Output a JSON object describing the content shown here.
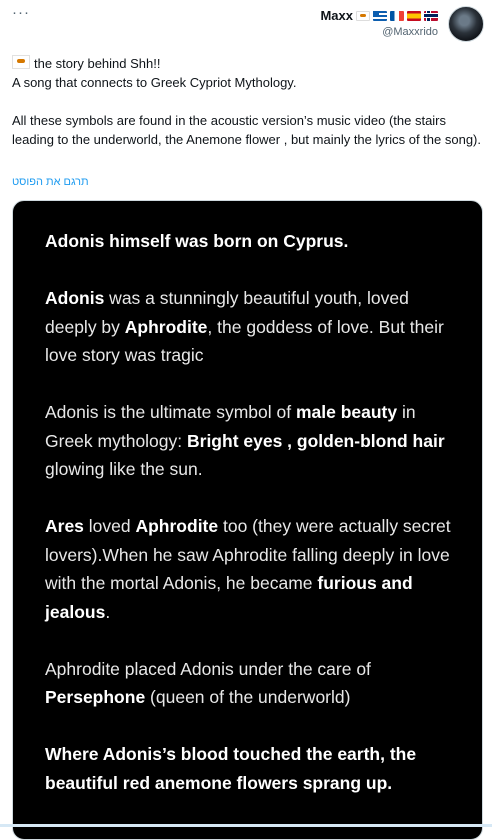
{
  "toolbar": {
    "more_label": "···"
  },
  "author": {
    "name": "Maxx",
    "handle": "@Maxxrido",
    "flags": [
      "cyprus-flag",
      "greece-flag",
      "france-flag",
      "spain-flag",
      "norway-flag"
    ]
  },
  "post": {
    "line1": "the story behind Shh!!",
    "line2": "A song that connects to Greek Cypriot Mythology.",
    "line3": "All these symbols are found in the acoustic version’s music video (the stairs leading to the underworld, the Anemone flower , but mainly the lyrics of the song).",
    "translate_label": "תרגם את הפוסט"
  },
  "image_text": {
    "p1": "Adonis himself was born on Cyprus.",
    "p2": {
      "b1": "Adonis",
      "t1": " was a stunningly beautiful youth, loved deeply by ",
      "b2": "Aphrodite",
      "t2": ", the goddess of love. But their love story was tragic"
    },
    "p3": {
      "t1": "Adonis is the ultimate symbol of ",
      "b1": "male beauty",
      "t2": " in Greek mythology: ",
      "b2": "Bright eyes , golden-blond hair",
      "t3": " glowing like the sun."
    },
    "p4": {
      "b1": "Ares",
      "t1": " loved ",
      "b2": "Aphrodite",
      "t2": " too (they were actually secret lovers).When he saw Aphrodite falling deeply in love with the mortal Adonis, he became ",
      "b3": "furious and jealous",
      "t3": "."
    },
    "p5": {
      "t1": "Aphrodite placed Adonis under the care of ",
      "b1": "Persephone",
      "t2": " (queen of the underworld)"
    },
    "p6": "Where Adonis’s blood touched the earth, the beautiful red anemone flowers sprang up."
  },
  "colors": {
    "link": "#1d9bf0",
    "secondary_text": "#536471",
    "media_bg": "#000000"
  }
}
